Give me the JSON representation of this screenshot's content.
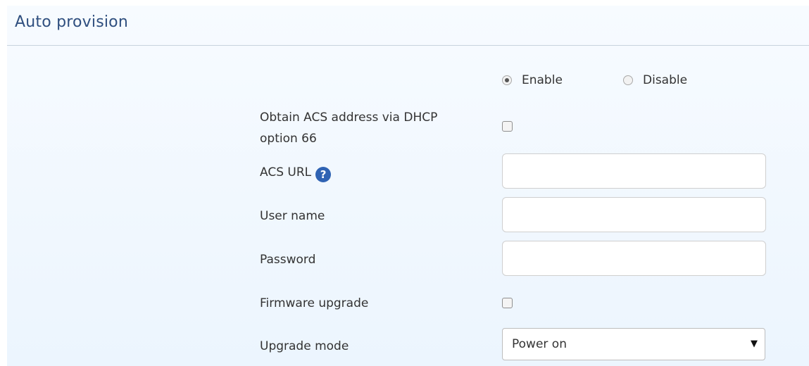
{
  "panel": {
    "title": "Auto provision"
  },
  "enable_radio": {
    "options": [
      {
        "label": "Enable",
        "selected": true
      },
      {
        "label": "Disable",
        "selected": false
      }
    ]
  },
  "fields": {
    "dhcp_label_line1": "Obtain ACS address via DHCP",
    "dhcp_label_line2": "option 66",
    "dhcp_checked": false,
    "acs_url_label": "ACS URL",
    "acs_url_help_icon": "question-mark-icon",
    "acs_url_value": "",
    "username_label": "User name",
    "username_value": "",
    "password_label": "Password",
    "password_value": "",
    "firmware_label": "Firmware upgrade",
    "firmware_checked": false,
    "upgrade_mode_label": "Upgrade mode",
    "upgrade_mode_value": "Power on"
  },
  "colors": {
    "title": "#2f4f7f",
    "help_icon": "#2f63b3",
    "panel_bg_top": "#f7fbff",
    "panel_bg_bottom": "#ecf5fe"
  }
}
